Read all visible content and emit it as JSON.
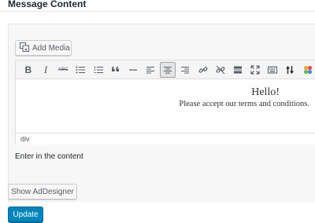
{
  "section": {
    "title": "Message Content"
  },
  "media": {
    "add_media_label": "Add Media"
  },
  "toolbar": {
    "bold_label": "B",
    "italic_label": "I",
    "strikethrough_label": "ABC",
    "buttons": [
      "bold",
      "italic",
      "strikethrough",
      "bullet-list",
      "numbered-list",
      "blockquote",
      "horizontal-line",
      "align-left",
      "align-center",
      "align-right",
      "insert-link",
      "remove-link",
      "read-more",
      "fullscreen",
      "keyboard",
      "sort-arrows",
      "colorful-plugin"
    ],
    "active_button": "align-center"
  },
  "editor": {
    "heading": "Hello!",
    "body": "Please accept our terms and conditions.",
    "status_path": "div"
  },
  "hint": "Enter in the content",
  "actions": {
    "adesigner_label": "Show AdDesigner",
    "update_label": "Update"
  },
  "colors": {
    "primary": "#0085ba",
    "primary_border": "#006799",
    "panel_bg": "#f7f7f7",
    "border": "#dddddd"
  }
}
